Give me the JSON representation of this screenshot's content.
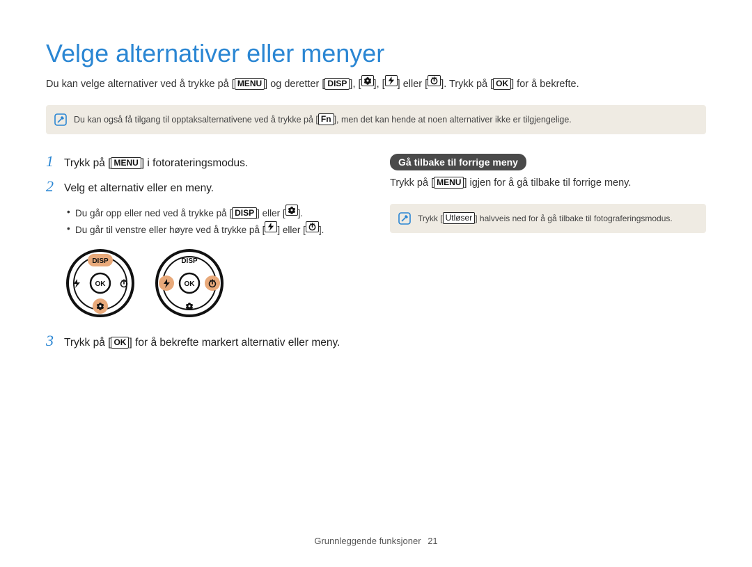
{
  "title": "Velge alternativer eller menyer",
  "intro": {
    "pre": "Du kan velge alternativer ved å trykke på [",
    "key_menu": "MENU",
    "after_menu": "] og deretter [",
    "key_disp": "DISP",
    "sep1": "], [",
    "sep2": "], [",
    "sep3": "] eller [",
    "after_icons": "]. Trykk på [",
    "key_ok": "OK",
    "tail": "] for å bekrefte."
  },
  "topnote": {
    "pre": "Du kan også få tilgang til opptaksalternativene ved å trykke på [",
    "key_fn": "Fn",
    "post": "], men det kan hende at noen alternativer ikke er tilgjengelige."
  },
  "steps": {
    "s1": {
      "num": "1",
      "pre": "Trykk på [",
      "key": "MENU",
      "post": "] i fotorateringsmodus."
    },
    "s2": {
      "num": "2",
      "text": "Velg et alternativ eller en meny."
    },
    "bullet1": {
      "pre": "Du går opp eller ned ved å trykke på [",
      "key": "DISP",
      "mid": "] eller [",
      "tail": "]."
    },
    "bullet2": {
      "pre": "Du går til venstre eller høyre ved å trykke på [",
      "mid": "] eller [",
      "tail": "]."
    },
    "s3": {
      "num": "3",
      "pre": "Trykk på [",
      "key": "OK",
      "post": "] for å bekrefte markert alternativ eller meny."
    }
  },
  "dial": {
    "disp": "DISP",
    "ok": "OK"
  },
  "right": {
    "pill": "Gå tilbake til forrige meny",
    "line": {
      "pre": "Trykk på [",
      "key": "MENU",
      "post": "] igjen for å gå tilbake til forrige meny."
    },
    "note": {
      "pre": "Trykk [",
      "key": "Utløser",
      "post": "] halvveis ned for å gå tilbake til fotograferingsmodus."
    }
  },
  "footer": {
    "section": "Grunnleggende funksjoner",
    "page": "21"
  }
}
